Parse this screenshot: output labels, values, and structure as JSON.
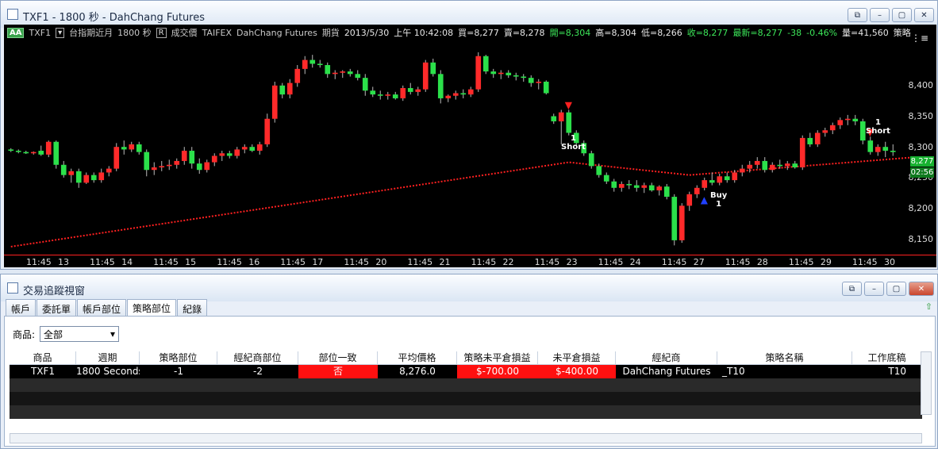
{
  "chart_window": {
    "title": "TXF1 - 1800 秒 - DahChang Futures",
    "header": {
      "aa": "AA",
      "symbol": "TXF1",
      "name": "台指期近月",
      "interval": "1800 秒",
      "r_box": "R",
      "kind": "成交價",
      "exchange": "TAIFEX",
      "broker": "DahChang Futures",
      "category": "期貨",
      "date": "2013/5/30",
      "time": "上午 10:42:08",
      "bid": "買=8,277",
      "ask": "賣=8,278",
      "open": "開=8,304",
      "high": "高=8,304",
      "low": "低=8,266",
      "close": "收=8,277",
      "last": "最新=8,277",
      "change": "-38",
      "change_pct": "-0.46%",
      "volume": "量=41,560",
      "strategy": "策略"
    },
    "menu_icon": "menu-icon",
    "y_ticks": [
      "8,400",
      "8,350",
      "8,300",
      "8,250",
      "8,200",
      "8,150"
    ],
    "last_price": "8,277",
    "countdown": "02:56",
    "x_labels": [
      "11:45",
      "13",
      "11:45",
      "14",
      "11:45",
      "15",
      "11:45",
      "16",
      "11:45",
      "17",
      "11:45",
      "20",
      "11:45",
      "21",
      "11:45",
      "22",
      "11:45",
      "23",
      "11:45",
      "24",
      "11:45",
      "27",
      "11:45",
      "28",
      "11:45",
      "29",
      "11:45",
      "30"
    ],
    "markers": [
      {
        "qty": "1",
        "label": "Short"
      },
      {
        "label": "Buy",
        "qty": "1"
      },
      {
        "qty": "1",
        "label": "Short"
      }
    ]
  },
  "chart_data": {
    "type": "candlestick",
    "y_range": [
      8130,
      8460
    ],
    "y_ticks": [
      8150,
      8200,
      8250,
      8300,
      8350,
      8400
    ],
    "candles_ohlc": [
      [
        8292,
        8294,
        8288,
        8290
      ],
      [
        8290,
        8292,
        8286,
        8288
      ],
      [
        8288,
        8290,
        8285,
        8286
      ],
      [
        8286,
        8289,
        8284,
        8288
      ],
      [
        8290,
        8298,
        8282,
        8284
      ],
      [
        8284,
        8306,
        8280,
        8304
      ],
      [
        8304,
        8306,
        8262,
        8268
      ],
      [
        8268,
        8274,
        8248,
        8252
      ],
      [
        8252,
        8262,
        8240,
        8258
      ],
      [
        8258,
        8262,
        8232,
        8240
      ],
      [
        8240,
        8256,
        8238,
        8252
      ],
      [
        8252,
        8256,
        8240,
        8244
      ],
      [
        8244,
        8262,
        8240,
        8256
      ],
      [
        8256,
        8266,
        8250,
        8262
      ],
      [
        8262,
        8302,
        8258,
        8296
      ],
      [
        8296,
        8306,
        8284,
        8292
      ],
      [
        8292,
        8304,
        8288,
        8300
      ],
      [
        8300,
        8304,
        8284,
        8288
      ],
      [
        8288,
        8292,
        8250,
        8260
      ],
      [
        8260,
        8272,
        8252,
        8264
      ],
      [
        8264,
        8274,
        8258,
        8266
      ],
      [
        8266,
        8276,
        8260,
        8268
      ],
      [
        8268,
        8278,
        8262,
        8274
      ],
      [
        8274,
        8296,
        8268,
        8290
      ],
      [
        8290,
        8296,
        8262,
        8270
      ],
      [
        8270,
        8278,
        8254,
        8260
      ],
      [
        8260,
        8276,
        8256,
        8272
      ],
      [
        8272,
        8286,
        8266,
        8282
      ],
      [
        8282,
        8290,
        8274,
        8286
      ],
      [
        8286,
        8290,
        8278,
        8282
      ],
      [
        8282,
        8296,
        8278,
        8292
      ],
      [
        8292,
        8300,
        8286,
        8296
      ],
      [
        8296,
        8300,
        8288,
        8290
      ],
      [
        8290,
        8304,
        8284,
        8300
      ],
      [
        8300,
        8348,
        8296,
        8340
      ],
      [
        8340,
        8398,
        8334,
        8392
      ],
      [
        8392,
        8396,
        8372,
        8378
      ],
      [
        8378,
        8402,
        8372,
        8396
      ],
      [
        8396,
        8424,
        8390,
        8418
      ],
      [
        8418,
        8438,
        8410,
        8432
      ],
      [
        8432,
        8440,
        8420,
        8426
      ],
      [
        8426,
        8432,
        8420,
        8424
      ],
      [
        8424,
        8428,
        8404,
        8410
      ],
      [
        8410,
        8416,
        8402,
        8412
      ],
      [
        8412,
        8416,
        8404,
        8414
      ],
      [
        8414,
        8418,
        8406,
        8410
      ],
      [
        8410,
        8416,
        8400,
        8404
      ],
      [
        8404,
        8410,
        8376,
        8384
      ],
      [
        8384,
        8390,
        8374,
        8378
      ],
      [
        8378,
        8384,
        8370,
        8376
      ],
      [
        8376,
        8382,
        8370,
        8378
      ],
      [
        8378,
        8382,
        8370,
        8372
      ],
      [
        8372,
        8392,
        8368,
        8388
      ],
      [
        8388,
        8396,
        8378,
        8382
      ],
      [
        8382,
        8390,
        8376,
        8386
      ],
      [
        8386,
        8432,
        8382,
        8428
      ],
      [
        8428,
        8434,
        8406,
        8410
      ],
      [
        8410,
        8416,
        8364,
        8372
      ],
      [
        8372,
        8378,
        8366,
        8376
      ],
      [
        8376,
        8384,
        8370,
        8380
      ],
      [
        8380,
        8386,
        8372,
        8378
      ],
      [
        8378,
        8390,
        8374,
        8386
      ],
      [
        8386,
        8444,
        8382,
        8438
      ],
      [
        8438,
        8440,
        8410,
        8414
      ],
      [
        8414,
        8418,
        8404,
        8410
      ],
      [
        8410,
        8416,
        8402,
        8412
      ],
      [
        8412,
        8416,
        8404,
        8408
      ],
      [
        8408,
        8412,
        8400,
        8406
      ],
      [
        8406,
        8410,
        8398,
        8404
      ],
      [
        8404,
        8408,
        8390,
        8396
      ],
      [
        8396,
        8402,
        8386,
        8398
      ],
      [
        8398,
        8400,
        8378,
        8380
      ],
      [
        8344,
        8348,
        8332,
        8336
      ],
      [
        8336,
        8354,
        8300,
        8350
      ],
      [
        8350,
        8354,
        8314,
        8318
      ],
      [
        8318,
        8322,
        8296,
        8302
      ],
      [
        8302,
        8306,
        8282,
        8286
      ],
      [
        8286,
        8290,
        8262,
        8266
      ],
      [
        8266,
        8270,
        8248,
        8252
      ],
      [
        8252,
        8256,
        8238,
        8242
      ],
      [
        8242,
        8246,
        8226,
        8232
      ],
      [
        8232,
        8242,
        8226,
        8238
      ],
      [
        8238,
        8244,
        8230,
        8236
      ],
      [
        8236,
        8244,
        8226,
        8232
      ],
      [
        8232,
        8240,
        8224,
        8236
      ],
      [
        8236,
        8240,
        8226,
        8228
      ],
      [
        8228,
        8236,
        8220,
        8234
      ],
      [
        8234,
        8238,
        8214,
        8218
      ],
      [
        8218,
        8222,
        8142,
        8150
      ],
      [
        8150,
        8208,
        8146,
        8204
      ],
      [
        8204,
        8226,
        8196,
        8222
      ],
      [
        8222,
        8236,
        8216,
        8232
      ],
      [
        8232,
        8248,
        8228,
        8244
      ],
      [
        8244,
        8256,
        8236,
        8240
      ],
      [
        8240,
        8254,
        8236,
        8250
      ],
      [
        8250,
        8256,
        8240,
        8244
      ],
      [
        8244,
        8260,
        8240,
        8256
      ],
      [
        8256,
        8268,
        8250,
        8262
      ],
      [
        8262,
        8274,
        8256,
        8268
      ],
      [
        8268,
        8280,
        8262,
        8274
      ],
      [
        8274,
        8280,
        8256,
        8260
      ],
      [
        8260,
        8272,
        8256,
        8268
      ],
      [
        8268,
        8276,
        8262,
        8266
      ],
      [
        8266,
        8274,
        8260,
        8270
      ],
      [
        8270,
        8274,
        8262,
        8264
      ],
      [
        8264,
        8314,
        8260,
        8310
      ],
      [
        8310,
        8318,
        8296,
        8300
      ],
      [
        8300,
        8322,
        8296,
        8318
      ],
      [
        8318,
        8326,
        8312,
        8322
      ],
      [
        8322,
        8334,
        8316,
        8330
      ],
      [
        8330,
        8342,
        8324,
        8338
      ],
      [
        8338,
        8346,
        8330,
        8340
      ],
      [
        8340,
        8346,
        8330,
        8336
      ],
      [
        8336,
        8340,
        8300,
        8306
      ],
      [
        8306,
        8312,
        8284,
        8288
      ],
      [
        8288,
        8300,
        8282,
        8296
      ],
      [
        8296,
        8304,
        8280,
        8290
      ],
      [
        8290,
        8300,
        8282,
        8288
      ]
    ],
    "avg_price_line": [
      [
        0,
        8140
      ],
      [
        74,
        8272
      ],
      [
        90,
        8252
      ],
      [
        120,
        8280
      ]
    ],
    "signals": [
      {
        "index": 74,
        "type": "Short"
      },
      {
        "index": 92,
        "type": "Buy"
      },
      {
        "index": 114,
        "type": "Short"
      }
    ],
    "colors": {
      "up": "#ff2a2a",
      "down": "#2be04a",
      "avg_line": "#ff2020"
    }
  },
  "trade_window": {
    "title": "交易追蹤視窗",
    "tabs": [
      "帳戶",
      "委託單",
      "帳戶部位",
      "策略部位",
      "紀錄"
    ],
    "filter_label": "商品:",
    "filter_value": "全部",
    "columns": [
      "商品",
      "週期",
      "策略部位",
      "經紀商部位",
      "部位一致",
      "平均價格",
      "策略未平倉損益",
      "未平倉損益",
      "經紀商",
      "策略名稱",
      "工作底稿"
    ],
    "row": {
      "product": "TXF1",
      "period": "1800 Seconds",
      "strategy_pos": "-1",
      "broker_pos": "-2",
      "consistent": "否",
      "avg_price": "8,276.0",
      "strategy_pnl": "$-700.00",
      "open_pnl": "$-400.00",
      "broker": "DahChang Futures",
      "strategy_name": "_T10",
      "worksheet": "T10"
    }
  }
}
